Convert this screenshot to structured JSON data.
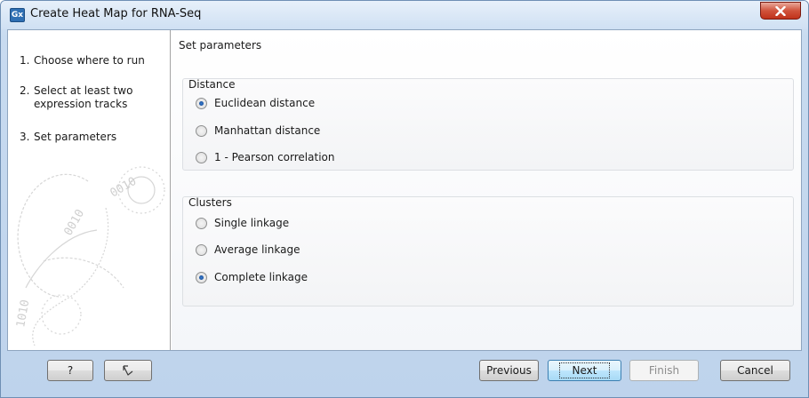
{
  "window": {
    "title": "Create Heat Map for RNA-Seq",
    "app_icon_text": "Gx"
  },
  "steps": [
    {
      "number": "1.",
      "label": "Choose where to run"
    },
    {
      "number": "2.",
      "label": "Select at least two expression tracks"
    },
    {
      "number": "3.",
      "label": "Set parameters"
    }
  ],
  "main": {
    "section_title": "Set parameters",
    "distance": {
      "title": "Distance",
      "options": [
        "Euclidean distance",
        "Manhattan distance",
        "1 - Pearson correlation"
      ],
      "selected": "Euclidean distance"
    },
    "clusters": {
      "title": "Clusters",
      "options": [
        "Single linkage",
        "Average linkage",
        "Complete linkage"
      ],
      "selected": "Complete linkage"
    }
  },
  "footer": {
    "help_label": "?",
    "previous_label": "Previous",
    "next_label": "Next",
    "finish_label": "Finish",
    "cancel_label": "Cancel"
  },
  "colors": {
    "title_bar": "#cfe0f3",
    "close_button": "#c0321a",
    "default_button": "#bee6fd",
    "radio_dot": "#0d3f8a"
  }
}
